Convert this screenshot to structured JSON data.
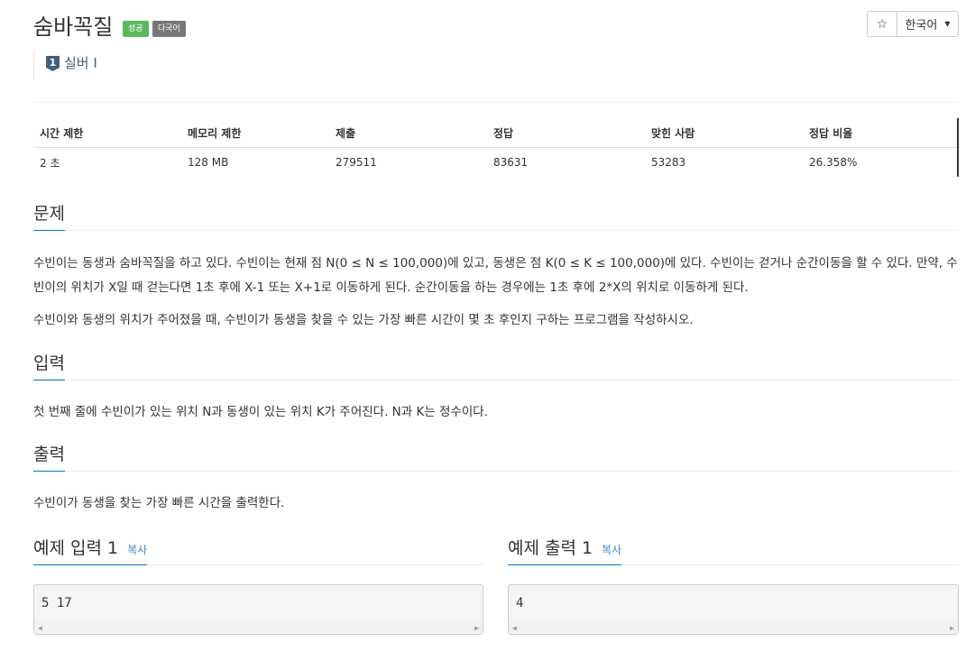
{
  "problem": {
    "title": "숨바꼭질",
    "badge_success": "성공",
    "badge_multi": "다국어",
    "tier_number": "1",
    "tier_label": "실버 I"
  },
  "toolbar": {
    "star_icon": "star-icon",
    "star_glyph": "☆",
    "language": "한국어"
  },
  "info_table": {
    "headers": [
      "시간 제한",
      "메모리 제한",
      "제출",
      "정답",
      "맞힌 사람",
      "정답 비율"
    ],
    "values": [
      "2 초",
      "128 MB",
      "279511",
      "83631",
      "53283",
      "26.358%"
    ]
  },
  "sections": {
    "problem_title": "문제",
    "problem_text_1": "수빈이는 동생과 숨바꼭질을 하고 있다. 수빈이는 현재 점 N(0 ≤ N ≤ 100,000)에 있고, 동생은 점 K(0 ≤ K ≤ 100,000)에 있다. 수빈이는 걷거나 순간이동을 할 수 있다. 만약, 수빈이의 위치가 X일 때 걷는다면 1초 후에 X-1 또는 X+1로 이동하게 된다. 순간이동을 하는 경우에는 1초 후에 2*X의 위치로 이동하게 된다.",
    "problem_text_2": "수빈이와 동생의 위치가 주어졌을 때, 수빈이가 동생을 찾을 수 있는 가장 빠른 시간이 몇 초 후인지 구하는 프로그램을 작성하시오.",
    "input_title": "입력",
    "input_text": "첫 번째 줄에 수빈이가 있는 위치 N과 동생이 있는 위치 K가 주어진다. N과 K는 정수이다.",
    "output_title": "출력",
    "output_text": "수빈이가 동생을 찾는 가장 빠른 시간을 출력한다."
  },
  "samples": {
    "input_title": "예제 입력 1",
    "output_title": "예제 출력 1",
    "copy_label": "복사",
    "input_value": "5 17",
    "output_value": "4"
  },
  "colors": {
    "success": "#5cb85c",
    "multi": "#777777",
    "tier": "#435f7a",
    "accent": "#0076c0",
    "link": "#428bca"
  }
}
